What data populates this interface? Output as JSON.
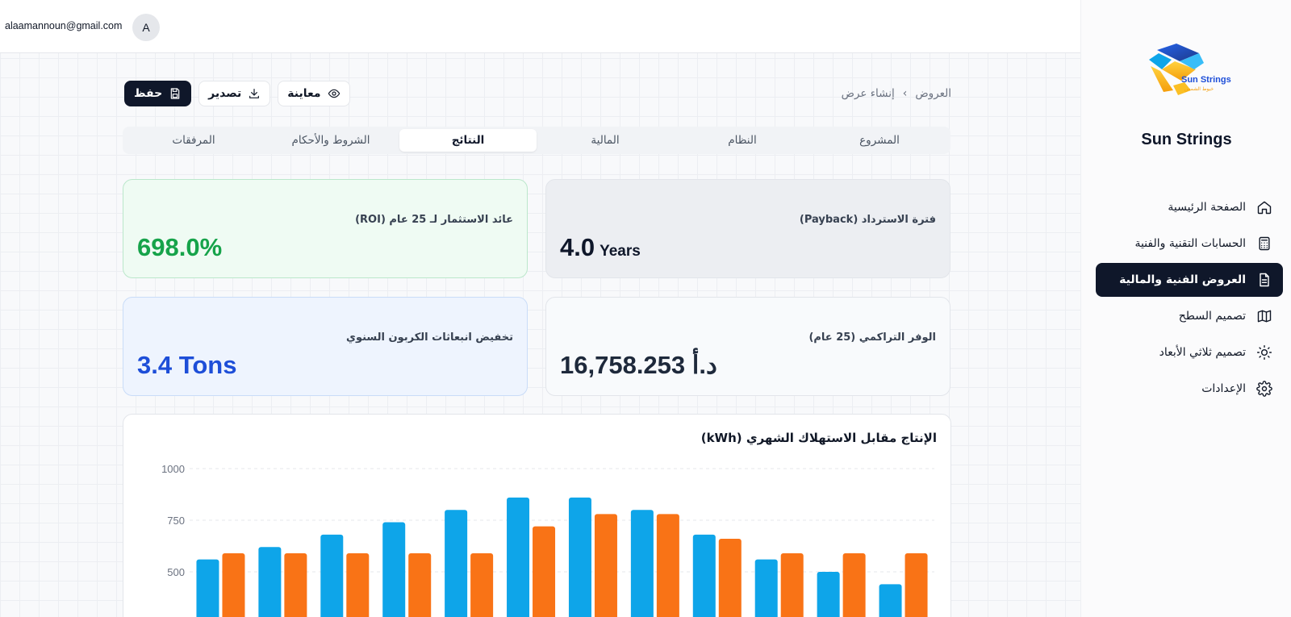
{
  "header": {
    "user_email": "alaamannoun@gmail.com",
    "avatar_initial": "A"
  },
  "sidebar": {
    "brand": "Sun Strings",
    "logo_text": "Sun Strings",
    "logo_subtext": "خيوط الشمس",
    "items": [
      {
        "label": "الصفحة الرئيسية",
        "icon": "home-icon",
        "active": false
      },
      {
        "label": "الحسابات التقنية والفنية",
        "icon": "calculator-icon",
        "active": false
      },
      {
        "label": "العروض الفنية والمالية",
        "icon": "document-icon",
        "active": true
      },
      {
        "label": "تصميم السطح",
        "icon": "map-icon",
        "active": false
      },
      {
        "label": "تصميم ثلاثي الأبعاد",
        "icon": "sun-icon",
        "active": false
      },
      {
        "label": "الإعدادات",
        "icon": "gear-icon",
        "active": false
      }
    ]
  },
  "breadcrumb": {
    "parent": "العروض",
    "current": "إنشاء عرض"
  },
  "actions": {
    "preview": "معاينة",
    "export": "تصدير",
    "save": "حفظ"
  },
  "tabs": [
    {
      "label": "المشروع",
      "active": false
    },
    {
      "label": "النظام",
      "active": false
    },
    {
      "label": "المالية",
      "active": false
    },
    {
      "label": "النتائج",
      "active": true
    },
    {
      "label": "الشروط والأحكام",
      "active": false
    },
    {
      "label": "المرفقات",
      "active": false
    }
  ],
  "metrics": {
    "payback": {
      "label": "فترة الاسترداد (Payback)",
      "value": "4.0",
      "unit": "Years",
      "color": "#0f172a"
    },
    "roi": {
      "label": "عائد الاستثمار لـ 25 عام (ROI)",
      "value": "698.0%",
      "color": "#16a34a"
    },
    "savings": {
      "label": "الوفر التراكمي (25 عام)",
      "value": "16,758.253 د.أ",
      "color": "#1e293b"
    },
    "carbon": {
      "label": "تخفيض انبعاثات الكربون السنوي",
      "value": "3.4 Tons",
      "color": "#1d4ed8"
    }
  },
  "chart_data": {
    "type": "bar",
    "title": "الإنتاج مقابل الاستهلاك الشهري (kWh)",
    "y_ticks": [
      1000,
      750,
      500
    ],
    "ylim": [
      250,
      1000
    ],
    "colors": [
      "#0ea5e9",
      "#f97316"
    ],
    "series": [
      {
        "values": [
          560,
          620,
          680,
          740,
          800,
          860,
          860,
          800,
          680,
          560,
          500,
          440
        ]
      },
      {
        "values": [
          590,
          590,
          590,
          590,
          590,
          720,
          780,
          780,
          660,
          590,
          590,
          590
        ]
      }
    ]
  }
}
